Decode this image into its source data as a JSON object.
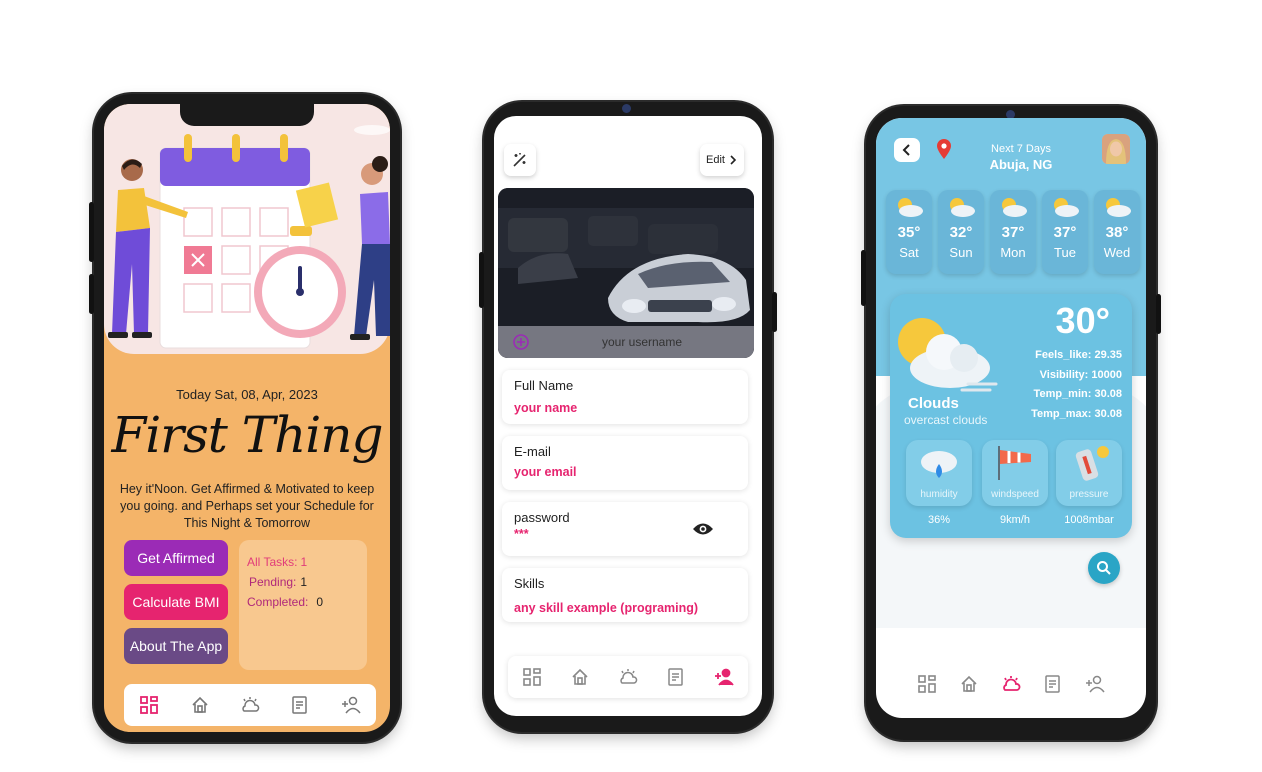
{
  "phone1": {
    "date": "Today Sat, 08, Apr, 2023",
    "title": "First Thing",
    "description": "Hey it'Noon. Get Affirmed & Motivated to keep you going. and Perhaps set your Schedule for This Night & Tomorrow",
    "buttons": {
      "affirmed": "Get Affirmed",
      "bmi": "Calculate BMI",
      "about": "About The App"
    },
    "stats": {
      "all_label": "All Tasks:",
      "all_value": "1",
      "pending_label": "Pending:",
      "pending_value": "1",
      "completed_label": "Completed:",
      "completed_value": "0"
    },
    "colors": {
      "background": "#f4b469",
      "affirmed": "#9b2bb6",
      "bmi": "#e6246f",
      "about": "#6a4a86",
      "active_nav": "#e6246f"
    }
  },
  "phone2": {
    "edit_label": "Edit",
    "username_placeholder": "your username",
    "fields": [
      {
        "label": "Full Name",
        "value": "your name"
      },
      {
        "label": "E-mail",
        "value": "your email"
      },
      {
        "label": "password",
        "value": "***"
      },
      {
        "label": "Skills",
        "value": "any skill example (programing)"
      }
    ]
  },
  "phone3": {
    "header_sub": "Next 7 Days",
    "location": "Abuja, NG",
    "forecast": [
      {
        "temp": "35°",
        "day": "Sat"
      },
      {
        "temp": "32°",
        "day": "Sun"
      },
      {
        "temp": "37°",
        "day": "Mon"
      },
      {
        "temp": "37°",
        "day": "Tue"
      },
      {
        "temp": "38°",
        "day": "Wed"
      }
    ],
    "current": {
      "temp": "30°",
      "feels_like": "Feels_like: 29.35",
      "visibility": "Visibility: 10000",
      "temp_min": "Temp_min: 30.08",
      "temp_max": "Temp_max: 30.08",
      "condition": "Clouds",
      "description": "overcast clouds"
    },
    "metrics": [
      {
        "label": "humidity",
        "value": "36%"
      },
      {
        "label": "windspeed",
        "value": "9km/h"
      },
      {
        "label": "pressure",
        "value": "1008mbar"
      }
    ]
  }
}
